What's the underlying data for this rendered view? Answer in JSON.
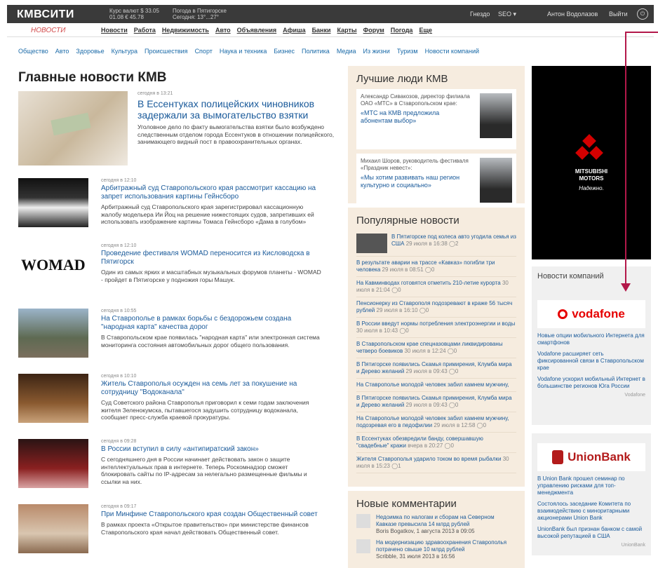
{
  "topbar": {
    "logo": "КМВСИТИ",
    "rate_l1": "Курс валют  $ 33.05",
    "rate_l2": "01.08  € 45.78",
    "weather_l1": "Погода в Пятигорске",
    "weather_l2": "Сегодня: 13°...27°",
    "gnezdo": "Гнездо",
    "seo": "SEO ▾",
    "user": "Антон Водолазов",
    "logout": "Выйти"
  },
  "mainnav": {
    "brand": "НОВОСТИ",
    "items": [
      "Новости",
      "Работа",
      "Недвижимость",
      "Авто",
      "Объявления",
      "Афиша",
      "Банки",
      "Карты",
      "Форум",
      "Погода",
      "Еще"
    ]
  },
  "catnav": [
    "Общество",
    "Авто",
    "Здоровье",
    "Культура",
    "Происшествия",
    "Спорт",
    "Наука и техника",
    "Бизнес",
    "Политика",
    "Медиа",
    "Из жизни",
    "Туризм",
    "Новости компаний"
  ],
  "main": {
    "heading": "Главные новости КМВ",
    "featured": {
      "time": "сегодня в 13:21",
      "title": "В Ессентуках полицейских чиновников задержали за вымогательство взятки",
      "text": "Уголовное дело по факту вымогательства взятки было возбуждено следственным отделом города Ессентуков в отношении полицейского, занимающего видный пост в правоохранительных органах."
    },
    "items": [
      {
        "time": "сегодня в 12:10",
        "title": "Арбитражный суд Ставропольского края рассмотрит кассацию на запрет использования картины Гейнсборо",
        "text": "Арбитражный суд Ставропольского края зарегистрировал кассационную жалобу модельера Ии Йоц на решение нижестоящих судов, запретивших ей использовать изображение картины Томаса Гейнсборо «Дама в голубом»"
      },
      {
        "time": "сегодня в 12:10",
        "title": "Проведение фестиваля WOMAD переносится из Кисловодска в Пятигорск",
        "text": "Один из самых ярких и масштабных музыкальных форумов планеты - WOMAD - пройдет в Пятигорске у подножия горы Машук."
      },
      {
        "time": "сегодня в 10:55",
        "title": "На Ставрополье в рамках борьбы с бездорожьем создана \"народная карта\" качества дорог",
        "text": "В Ставропольском крае появилась \"народная карта\" или электронная система мониторинга состояния автомобильных дорог общего пользования."
      },
      {
        "time": "сегодня в 10:10",
        "title": "Житель Ставрополья осужден на семь лет за покушение на сотрудницу \"Водоканала\"",
        "text": "Суд Советского района Ставрополья приговорил к семи годам заключения жителя Зеленокумска, пытавшегося задушить сотрудницу водоканала, сообщает пресс-служба краевой прокуратуры."
      },
      {
        "time": "сегодня в 09:28",
        "title": "В России вступил в силу «антипиратский закон»",
        "text": "С сегодняшнего дня в России начинает действовать закон о защите интеллектуальных прав в интернете. Теперь Роскомнадзор сможет блокировать сайты по IP-адресам за нелегально размещенные фильмы и ссылки на них."
      },
      {
        "time": "сегодня в 09:17",
        "title": "При Минфине Ставропольского края создан Общественный совет",
        "text": "В рамках проекта «Открытое правительство» при министерстве финансов Ставропольского края начал действовать Общественный совет."
      }
    ]
  },
  "best": {
    "title": "Лучшие люди КМВ",
    "people": [
      {
        "desc": "Александр Сивакозов, директор филиала ОАО «МТС» в Ставропольском крае:",
        "quote": "«МТС на КМВ предложила абонентам выбор»"
      },
      {
        "desc": "Михаил Шоров, руководитель фестиваля «Праздник невест»:",
        "quote": "«Мы хотим развивать наш регион культурно и социально»"
      }
    ]
  },
  "popular": {
    "title": "Популярные новости",
    "items": [
      {
        "t": "В Пятигорске под колеса авто угодила семья из США",
        "m": "29 июля в 16:38  ◯2"
      },
      {
        "t": "В результате аварии на трассе «Кавказ» погибли три человека",
        "m": "29 июля в 08:51  ◯0"
      },
      {
        "t": "На Кавминводах готовятся отметить 210-летие курорта",
        "m": "30 июля в 21:04  ◯0"
      },
      {
        "t": "Пенсионерку из Ставрополя подозревают в краже 56 тысяч рублей",
        "m": "29 июля в 16:10  ◯0"
      },
      {
        "t": "В России введут нормы потребления электроэнергии и воды",
        "m": "30 июля в 10:43  ◯0"
      },
      {
        "t": "В Ставропольском крае спецназовцами ликвидированы четверо боевиков",
        "m": "30 июля в 12:24  ◯0"
      },
      {
        "t": "В Пятигорске появились Скамья примирения, Клумба мира и Дерево желаний",
        "m": "29 июля в 09:43  ◯0"
      },
      {
        "t": "На Ставрополье молодой человек забил камнем мужчину,",
        "m": ""
      },
      {
        "t": "В Пятигорске появились Скамья примирения, Клумба мира и Дерево желаний",
        "m": "29 июля в 09:43  ◯0"
      },
      {
        "t": "На Ставрополье молодой человек забил камнем мужчину, подозревая его в педофилии",
        "m": "29 июля в 12:58  ◯0"
      },
      {
        "t": "В Ессентуках обезвредили банду, совершавшую \"свадебные\" кражи",
        "m": "вчера в 20:27  ◯0"
      },
      {
        "t": "Жителя Ставрополья ударило током во время рыбалки",
        "m": "30 июля в 15:23  ◯1"
      }
    ]
  },
  "comments": {
    "title": "Новые комментарии",
    "items": [
      {
        "t": "Недоимка по налогам и сборам на Северном Кавказе превысила 14 млрд рублей",
        "a": "Boris Bogatkov, 1 августа 2013 в 09:05"
      },
      {
        "t": "На модернизацию здравоохранения Ставрополья потрачено свыше 10 млрд рублей",
        "a": "Scribble, 31 июля 2013 в 16:56"
      }
    ]
  },
  "ad": {
    "brand": "MITSUBISHI",
    "brand2": "MOTORS",
    "slogan": "Надежно."
  },
  "companies": {
    "title": "Новости компаний",
    "vodafone": {
      "name": "vodafone",
      "news": [
        "Новые опции мобильного Интернета для смартфонов",
        "Vodafone расширяет сеть фиксированной связи в Ставропольском крае",
        "Vodafone ускорил мобильный Интернет в большинстве регионов Юга России"
      ],
      "source": "Vodafone"
    },
    "unionbank": {
      "name": "UnionBank",
      "news": [
        "В Union Bank прошел семинар по управлению рисками для топ-менеджмента",
        "Состоялось заседание Комитета по взаимодействию с миноритарными акционерами Union Bank",
        "UnionBank был признан банком с самой высокой репутацией в США"
      ],
      "source": "UnionBank"
    }
  },
  "colors": {
    "accent": "#1a5a9a",
    "arrow": "#b3184a"
  }
}
